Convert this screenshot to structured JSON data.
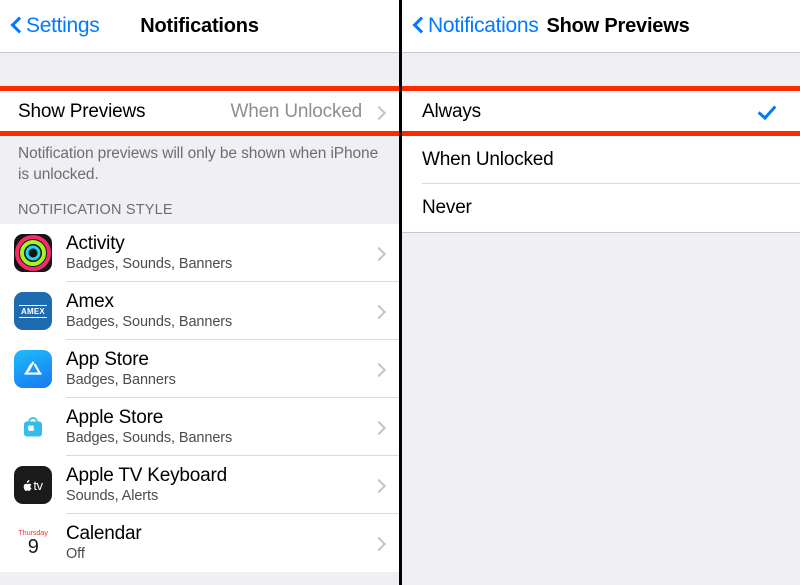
{
  "left_panel": {
    "navbar": {
      "back_label": "Settings",
      "title": "Notifications",
      "back_icon": "chevron-left-icon"
    },
    "show_previews_row": {
      "title": "Show Previews",
      "value": "When Unlocked",
      "chevron_icon": "chevron-right-icon"
    },
    "footer_text": "Notification previews will only be shown when iPhone is unlocked.",
    "section_header": "NOTIFICATION STYLE",
    "apps": [
      {
        "name": "Activity",
        "detail": "Badges, Sounds, Banners",
        "icon": "activity-rings-icon"
      },
      {
        "name": "Amex",
        "detail": "Badges, Sounds, Banners",
        "icon": "amex-icon",
        "icon_text": "AMEX"
      },
      {
        "name": "App Store",
        "detail": "Badges, Banners",
        "icon": "app-store-icon"
      },
      {
        "name": "Apple Store",
        "detail": "Badges, Sounds, Banners",
        "icon": "apple-store-bag-icon"
      },
      {
        "name": "Apple TV Keyboard",
        "detail": "Sounds, Alerts",
        "icon": "apple-tv-icon",
        "icon_text": "tv"
      },
      {
        "name": "Calendar",
        "detail": "Off",
        "icon": "calendar-icon",
        "icon_day": "Thursday",
        "icon_date": "9"
      }
    ]
  },
  "right_panel": {
    "navbar": {
      "back_label": "Notifications",
      "title": "Show Previews",
      "back_icon": "chevron-left-icon"
    },
    "options": [
      {
        "label": "Always",
        "selected": true,
        "check_icon": "checkmark-icon"
      },
      {
        "label": "When Unlocked",
        "selected": false
      },
      {
        "label": "Never",
        "selected": false
      }
    ]
  },
  "annotations": {
    "highlight_color": "#fa2d00",
    "left_box_target": "Show Previews",
    "right_box_target": "Always"
  },
  "colors": {
    "accent_blue": "#007aff",
    "group_background": "#efeff4",
    "row_background": "#ffffff",
    "secondary_text": "#8e8e93",
    "highlight_red": "#fa2d00"
  }
}
